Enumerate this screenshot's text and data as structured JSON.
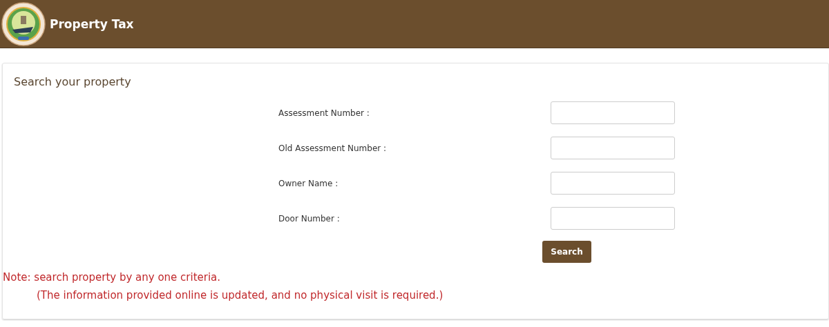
{
  "header": {
    "title": "Property Tax"
  },
  "card": {
    "title": "Search your property",
    "fields": [
      {
        "label": "Assessment Number :"
      },
      {
        "label": "Old Assessment Number :"
      },
      {
        "label": "Owner Name :"
      },
      {
        "label": "Door Number :"
      }
    ],
    "button": "Search",
    "notes": [
      "Note: search property by any one criteria.",
      "(The information provided online is updated, and no physical visit is required.)"
    ]
  }
}
